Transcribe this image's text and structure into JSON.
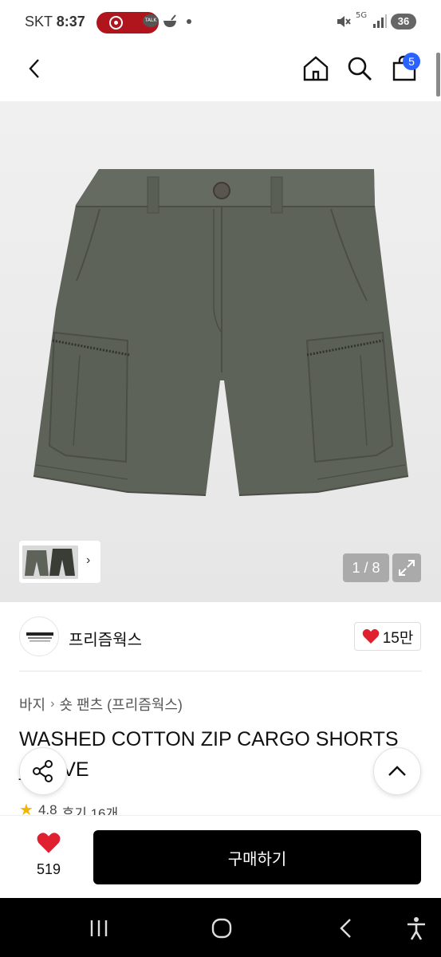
{
  "status_bar": {
    "carrier": "SKT",
    "time": "8:37",
    "talk_icon_text": "TALK",
    "network": "5G",
    "battery": "36"
  },
  "header": {
    "cart_count": "5"
  },
  "gallery": {
    "counter": "1 / 8"
  },
  "brand": {
    "name": "프리즘웍스",
    "logo_text": "PRIZMWORKS",
    "likes": "15만"
  },
  "breadcrumb": {
    "category": "바지",
    "subcategory": "숏 팬츠 (프리즘웍스)"
  },
  "product": {
    "title": "WASHED COTTON ZIP CARGO SHORTS _OLIVE",
    "rating": "4.8",
    "reviews": "후기 16개"
  },
  "action_bar": {
    "like_count": "519",
    "buy_label": "구매하기"
  },
  "colors": {
    "accent_badge": "#2962ff",
    "heart": "#e0202f",
    "product_olive": "#5e6359"
  }
}
